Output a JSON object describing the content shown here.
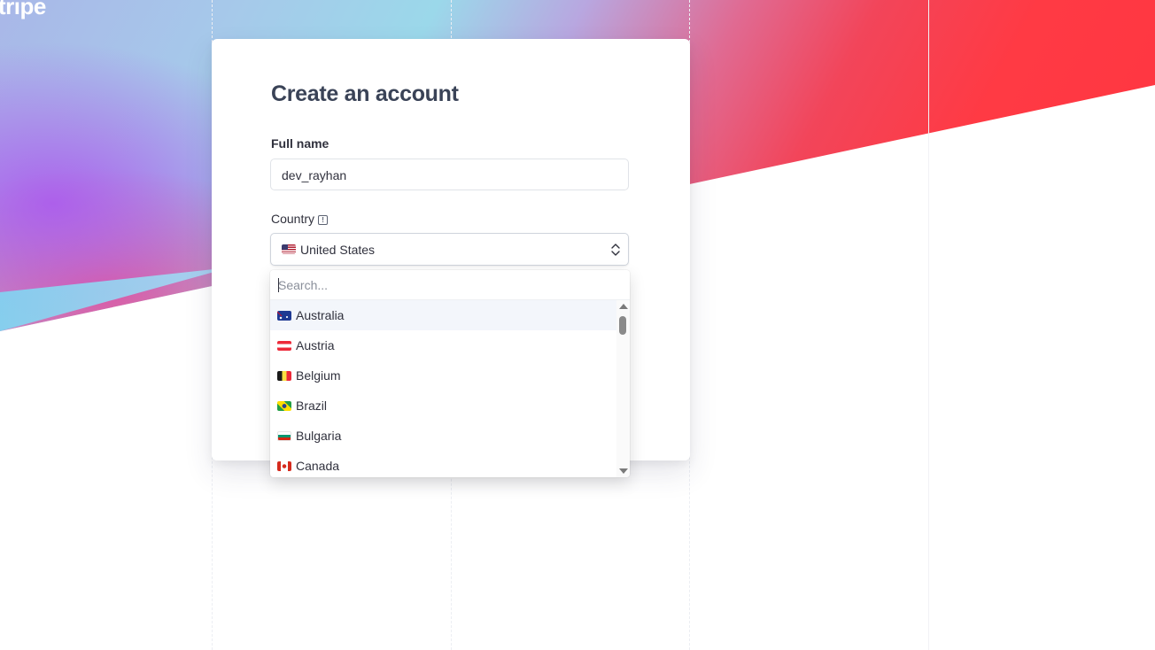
{
  "brand": {
    "logo_text": "tripe"
  },
  "form": {
    "title": "Create an account",
    "full_name_label": "Full name",
    "full_name_value": "dev_rayhan",
    "country_label": "Country",
    "country_selected": "United States",
    "country_selected_flag": "us-flag-icon"
  },
  "dropdown": {
    "search_placeholder": "Search...",
    "options": [
      {
        "label": "Australia",
        "flag": "au-flag-icon",
        "highlighted": true
      },
      {
        "label": "Austria",
        "flag": "at-flag-icon"
      },
      {
        "label": "Belgium",
        "flag": "be-flag-icon"
      },
      {
        "label": "Brazil",
        "flag": "br-flag-icon"
      },
      {
        "label": "Bulgaria",
        "flag": "bg-flag-icon"
      },
      {
        "label": "Canada",
        "flag": "ca-flag-icon"
      }
    ]
  },
  "colors": {
    "title": "#3a4357",
    "text": "#30313d",
    "accent": "#5a54e0",
    "gradient_red": "#ff3440",
    "gradient_purple": "#ac5cec",
    "gradient_cyan": "#9bd8ea"
  }
}
